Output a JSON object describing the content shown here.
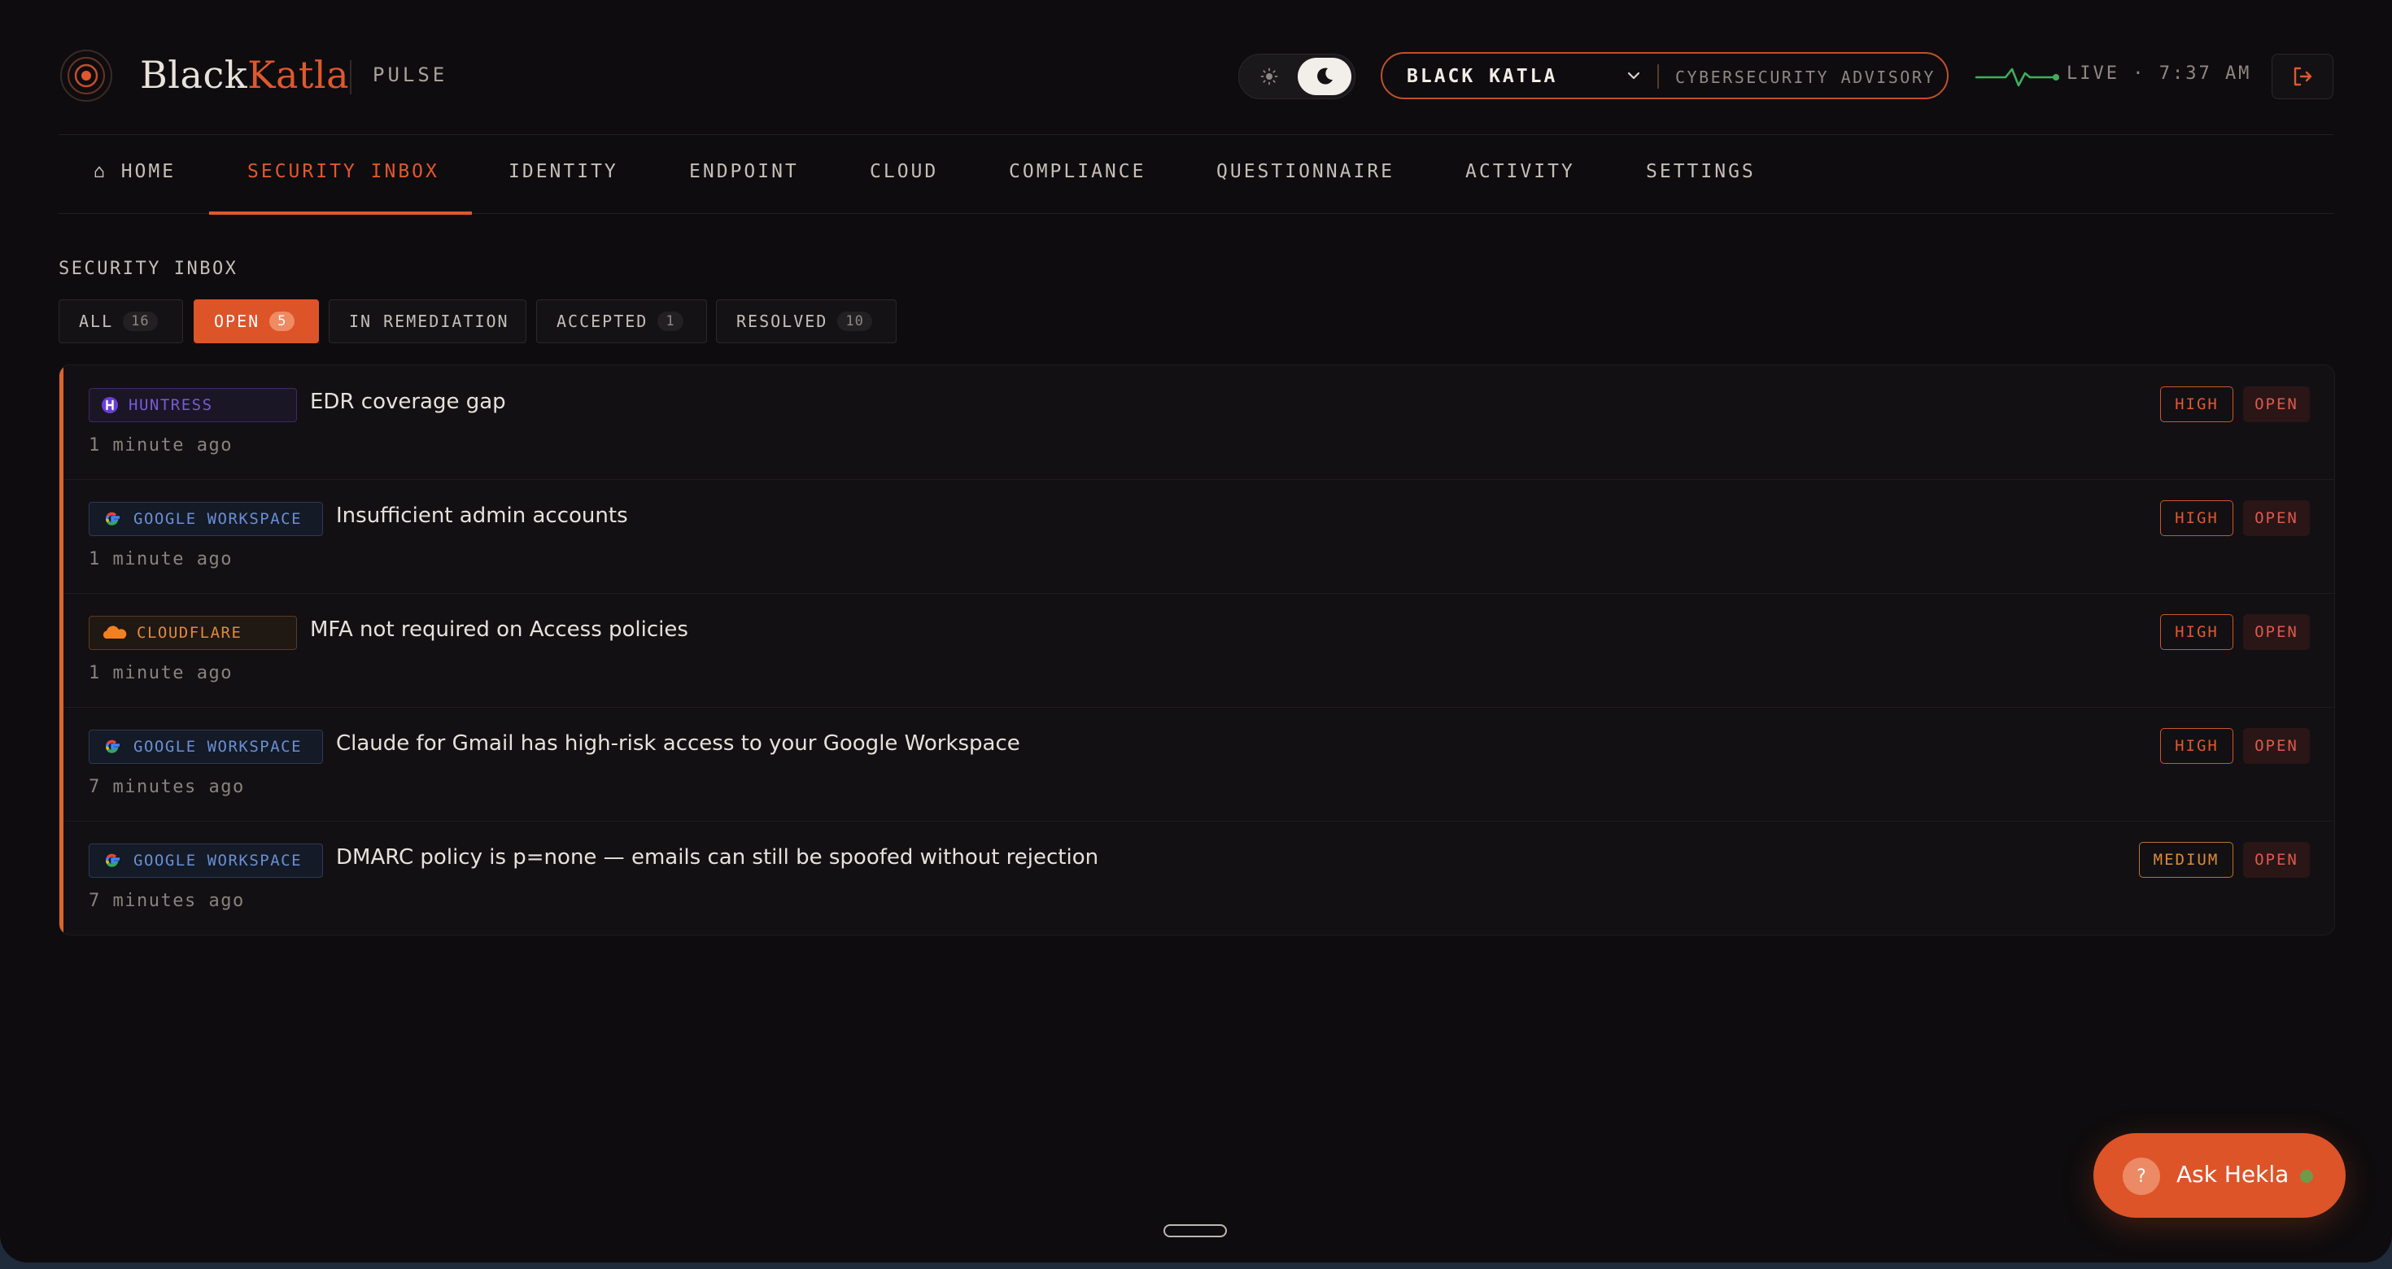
{
  "header": {
    "brand_part1": "Black",
    "brand_part2": "Katla",
    "product": "PULSE",
    "org_name": "BLACK KATLA",
    "org_subtitle": "CYBERSECURITY ADVISORY",
    "live_status": "LIVE · 7:37 AM",
    "theme": "dark"
  },
  "nav": {
    "items": [
      {
        "label": "⌂ HOME"
      },
      {
        "label": "SECURITY INBOX",
        "active": true
      },
      {
        "label": "IDENTITY"
      },
      {
        "label": "ENDPOINT"
      },
      {
        "label": "CLOUD"
      },
      {
        "label": "COMPLIANCE"
      },
      {
        "label": "QUESTIONNAIRE"
      },
      {
        "label": "ACTIVITY"
      },
      {
        "label": "SETTINGS"
      }
    ]
  },
  "inbox": {
    "title": "SECURITY INBOX",
    "filters": [
      {
        "label": "ALL",
        "count": "16"
      },
      {
        "label": "OPEN",
        "count": "5",
        "active": true
      },
      {
        "label": "IN REMEDIATION",
        "count": ""
      },
      {
        "label": "ACCEPTED",
        "count": "1"
      },
      {
        "label": "RESOLVED",
        "count": "10"
      }
    ],
    "items": [
      {
        "source": "HUNTRESS",
        "source_icon": "huntress-icon",
        "title": "EDR coverage gap",
        "time": "1 minute ago",
        "severity": "HIGH",
        "status": "OPEN"
      },
      {
        "source": "GOOGLE WORKSPACE",
        "source_icon": "google-icon",
        "title": "Insufficient admin accounts",
        "time": "1 minute ago",
        "severity": "HIGH",
        "status": "OPEN"
      },
      {
        "source": "CLOUDFLARE",
        "source_icon": "cloudflare-icon",
        "title": "MFA not required on Access policies",
        "time": "1 minute ago",
        "severity": "HIGH",
        "status": "OPEN"
      },
      {
        "source": "GOOGLE WORKSPACE",
        "source_icon": "google-icon",
        "title": "Claude for Gmail has high-risk access to your Google Workspace",
        "time": "7 minutes ago",
        "severity": "HIGH",
        "status": "OPEN"
      },
      {
        "source": "GOOGLE WORKSPACE",
        "source_icon": "google-icon",
        "title": "DMARC policy is p=none — emails can still be spoofed without rejection",
        "time": "7 minutes ago",
        "severity": "MEDIUM",
        "status": "OPEN"
      }
    ]
  },
  "assistant": {
    "label": "Ask Hekla",
    "icon_glyph": "?"
  },
  "colors": {
    "accent": "#dd5428",
    "background": "#0e0c0e",
    "live": "#3fae5a"
  }
}
